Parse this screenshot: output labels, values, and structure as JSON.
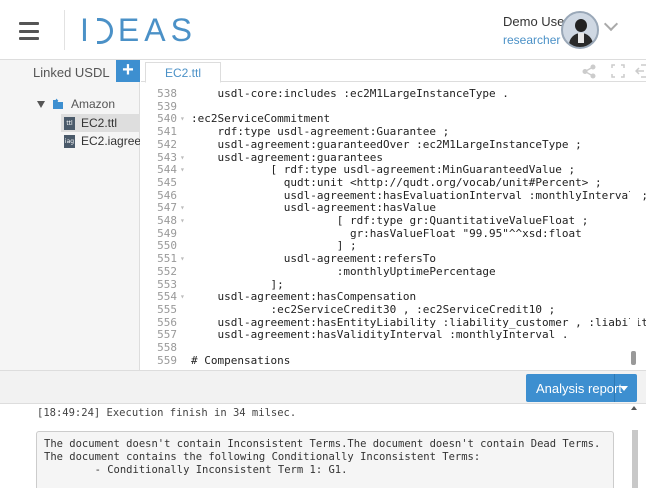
{
  "header": {
    "menu_icon": "hamburger-icon",
    "logo_prefix": "I",
    "logo_suffix": "EAS",
    "user_name": "Demo User",
    "user_role": "researcher",
    "avatar_icon": "user-avatar-icon"
  },
  "sidebar": {
    "title": "Linked USDL",
    "add_label": "+",
    "root": "Amazon",
    "files": [
      {
        "label": "EC2.ttl",
        "selected": true
      },
      {
        "label": "EC2.iagreete",
        "selected": false
      }
    ]
  },
  "editor": {
    "tab_label": "EC2.ttl",
    "lines": [
      {
        "n": "538",
        "fold": "",
        "text": "    usdl-core:includes :ec2M1LargeInstanceType ."
      },
      {
        "n": "539",
        "fold": "",
        "text": ""
      },
      {
        "n": "540",
        "fold": "▾",
        "text": ":ec2ServiceCommitment"
      },
      {
        "n": "541",
        "fold": "",
        "text": "    rdf:type usdl-agreement:Guarantee ;"
      },
      {
        "n": "542",
        "fold": "",
        "text": "    usdl-agreement:guaranteedOver :ec2M1LargeInstanceType ;"
      },
      {
        "n": "543",
        "fold": "▾",
        "text": "    usdl-agreement:guarantees"
      },
      {
        "n": "544",
        "fold": "▾",
        "text": "            [ rdf:type usdl-agreement:MinGuaranteedValue ;"
      },
      {
        "n": "545",
        "fold": "",
        "text": "              qudt:unit <http://qudt.org/vocab/unit#Percent> ;"
      },
      {
        "n": "546",
        "fold": "",
        "text": "              usdl-agreement:hasEvaluationInterval :monthlyInterval ;"
      },
      {
        "n": "547",
        "fold": "▾",
        "text": "              usdl-agreement:hasValue"
      },
      {
        "n": "548",
        "fold": "▾",
        "text": "                      [ rdf:type gr:QuantitativeValueFloat ;"
      },
      {
        "n": "549",
        "fold": "",
        "text": "                        gr:hasValueFloat \"99.95\"^^xsd:float"
      },
      {
        "n": "550",
        "fold": "",
        "text": "                      ] ;"
      },
      {
        "n": "551",
        "fold": "▾",
        "text": "              usdl-agreement:refersTo"
      },
      {
        "n": "552",
        "fold": "",
        "text": "                      :monthlyUptimePercentage"
      },
      {
        "n": "553",
        "fold": "",
        "text": "            ];"
      },
      {
        "n": "554",
        "fold": "▾",
        "text": "    usdl-agreement:hasCompensation"
      },
      {
        "n": "555",
        "fold": "",
        "text": "            :ec2ServiceCredit30 , :ec2ServiceCredit10 ;"
      },
      {
        "n": "556",
        "fold": "",
        "text": "    usdl-agreement:hasEntityLiability :liability_customer , :liability_Am"
      },
      {
        "n": "557",
        "fold": "",
        "text": "    usdl-agreement:hasValidityInterval :monthlyInterval ."
      },
      {
        "n": "558",
        "fold": "",
        "text": ""
      },
      {
        "n": "559",
        "fold": "",
        "text": "# Compensations"
      }
    ]
  },
  "toolbar": {
    "share_icon": "share-icon",
    "fullscreen_icon": "fullscreen-icon",
    "exit_icon": "exit-icon"
  },
  "analysis": {
    "button_label": "Analysis report"
  },
  "console": {
    "log": "[18:49:24] Execution finish in 34 milsec.",
    "report_lines": [
      "The document doesn't contain Inconsistent Terms.The document doesn't contain Dead Terms.",
      "The document contains the following Conditionally Inconsistent Terms:",
      "        - Conditionally Inconsistent Term 1: G1."
    ]
  }
}
